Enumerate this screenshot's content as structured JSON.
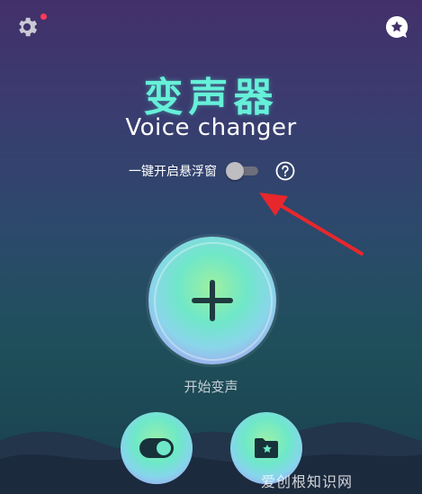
{
  "header": {
    "settings_icon": "gear-icon",
    "notification_dot": true,
    "favorite_icon": "star-bubble-icon"
  },
  "title": {
    "chinese": "变声器",
    "english": "Voice changer"
  },
  "floating_window": {
    "label": "一键开启悬浮窗",
    "toggle_on": false,
    "help_icon": "question-circle-icon"
  },
  "main": {
    "start_button_icon": "plus-icon",
    "start_label": "开始变声"
  },
  "bottom": {
    "left_button_icon": "toggle-switch-icon",
    "right_button_icon": "star-folder-icon"
  },
  "colors": {
    "accent": "#66f0d8",
    "annotation_arrow": "#e8272c"
  },
  "watermark": "爱创根知识网"
}
